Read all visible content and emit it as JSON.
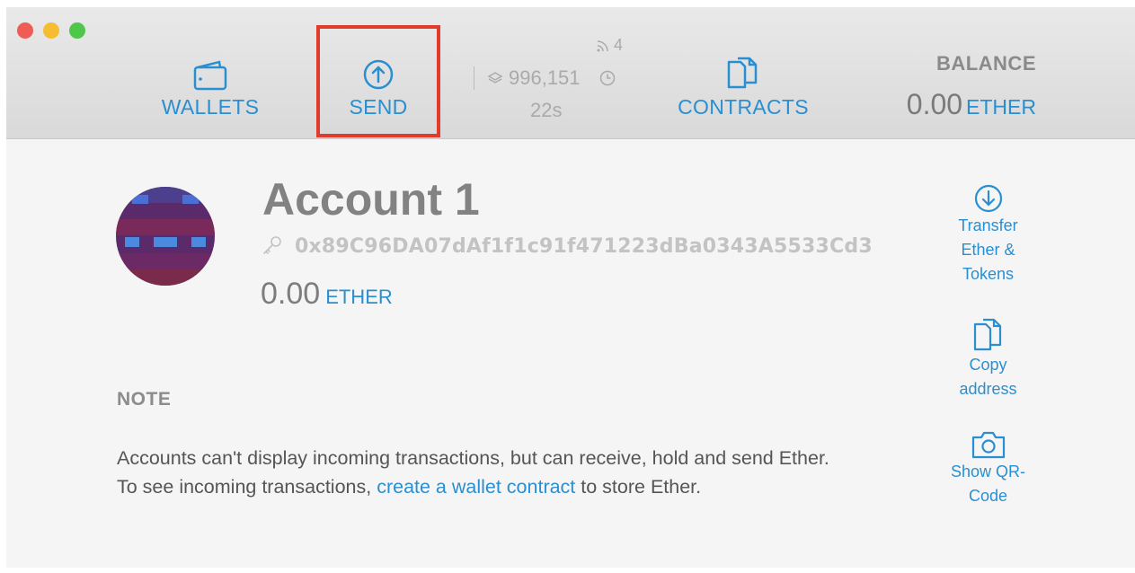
{
  "header": {
    "nav": {
      "wallets_label": "WALLETS",
      "send_label": "SEND",
      "contracts_label": "CONTRACTS"
    },
    "status": {
      "peers": "4",
      "block_number": "996,151",
      "time_since_block": "22s"
    },
    "balance": {
      "label": "BALANCE",
      "value": "0.00",
      "unit": "ETHER"
    }
  },
  "account": {
    "name": "Account 1",
    "address": "0x89C96DA07dAf1f1c91f471223dBa0343A5533Cd3",
    "balance_value": "0.00",
    "balance_unit": "ETHER"
  },
  "note": {
    "title": "NOTE",
    "line1": "Accounts can't display incoming transactions, but can receive, hold and send Ether.",
    "line2_before": "To see incoming transactions, ",
    "line2_link": "create a wallet contract",
    "line2_after": " to store Ether."
  },
  "actions": {
    "transfer": [
      "Transfer",
      "Ether &",
      "Tokens"
    ],
    "copy": [
      "Copy",
      "address"
    ],
    "qr": [
      "Show QR-",
      "Code"
    ]
  },
  "colors": {
    "accent_blue": "#2a8fd1",
    "highlight_red": "#e03c2c",
    "avatar_purple": "#5a2a6a"
  }
}
